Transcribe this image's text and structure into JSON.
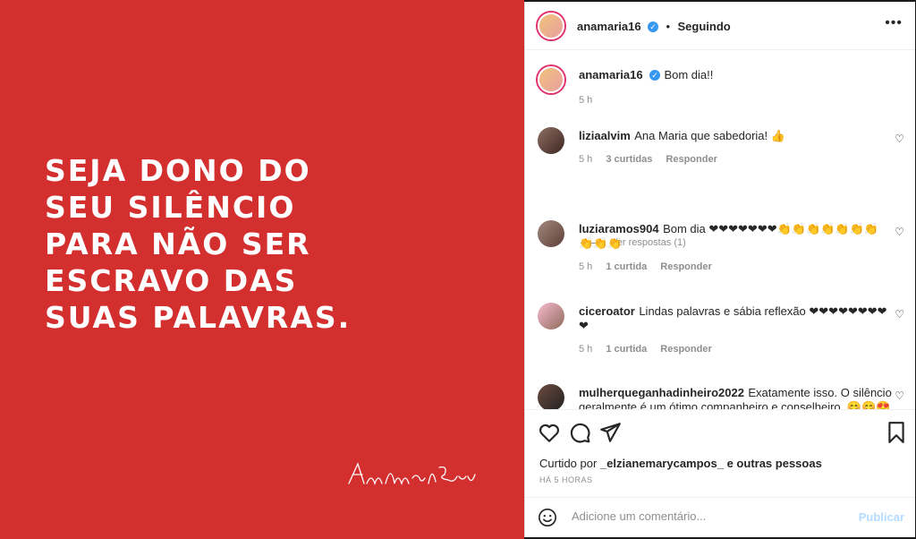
{
  "post": {
    "quote": "SEJA DONO DO\nSEU SILÊNCIO\nPARA NÃO SER\nESCRAVO DAS\nSUAS PALAVRAS.",
    "signature": "Ana Maria Braga"
  },
  "header": {
    "username": "anamaria16",
    "separator": "•",
    "follow_status": "Seguindo"
  },
  "caption": {
    "username": "anamaria16",
    "text": "Bom dia!!",
    "time": "5 h"
  },
  "comments": [
    {
      "username": "liziaalvim",
      "text": "Ana Maria que sabedoria! 👍",
      "time": "5 h",
      "likes": "3 curtidas",
      "reply": "Responder"
    },
    {
      "username": "luziaramos904",
      "text": "Bom dia ❤❤❤❤❤❤❤👏👏👏👏👏👏👏👏👏👏",
      "time": "5 h",
      "likes": "1 curtida",
      "reply": "Responder"
    },
    {
      "username": "ciceroator",
      "text": "Lindas palavras e sábia reflexão ❤❤❤❤❤❤❤❤❤",
      "time": "5 h",
      "likes": "1 curtida",
      "reply": "Responder"
    },
    {
      "username": "mulherqueganhadinheiro2022",
      "text": "Exatamente isso. O silêncio geralmente é um ótimo companheiro e conselheiro. 😊😊😍",
      "time": "",
      "likes": "",
      "reply": ""
    }
  ],
  "view_replies": "Ver respostas (1)",
  "likes": {
    "prefix": "Curtido por",
    "user": "_elzianemarycampos_",
    "suffix": "e outras pessoas"
  },
  "date": "HÁ 5 HORAS",
  "add_comment": {
    "placeholder": "Adicione um comentário...",
    "publish": "Publicar"
  },
  "colors": {
    "post_background": "#d32f2f",
    "verified": "#3897f0",
    "publish_disabled": "#b3dbff"
  }
}
